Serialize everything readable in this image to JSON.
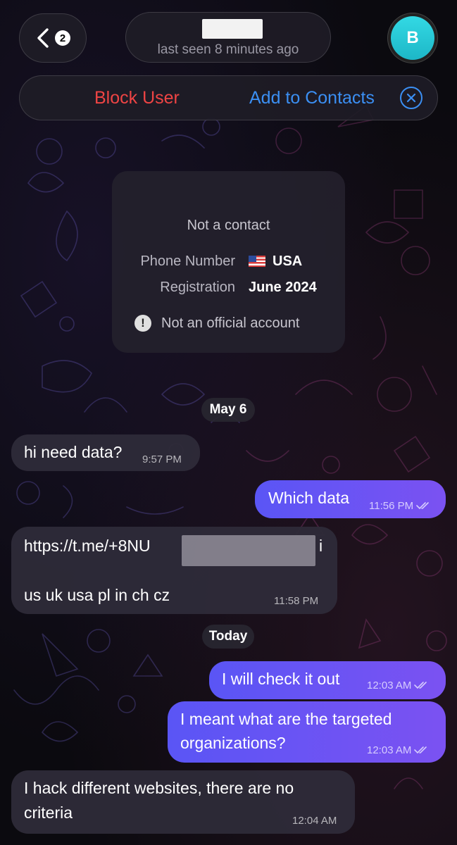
{
  "header": {
    "back_badge": "2",
    "last_seen": "last seen 8 minutes ago",
    "avatar_letter": "B"
  },
  "action_bar": {
    "block_label": "Block User",
    "add_contacts_label": "Add to Contacts"
  },
  "info_card": {
    "title": "Not a contact",
    "phone_label": "Phone Number",
    "phone_value": "USA",
    "registration_label": "Registration",
    "registration_value": "June 2024",
    "official_note": "Not an official account"
  },
  "dates": [
    "May 6",
    "Today"
  ],
  "messages": [
    {
      "direction": "in",
      "text": "hi need data?",
      "time": "9:57 PM"
    },
    {
      "direction": "out",
      "text": "Which data",
      "time": "11:56 PM"
    },
    {
      "direction": "in",
      "line1_start": "https://t.me/+8NU",
      "line1_end": "i",
      "line2": "us uk usa pl in ch cz",
      "time": "11:58 PM"
    },
    {
      "direction": "out",
      "text": "I will check it out",
      "time": "12:03 AM"
    },
    {
      "direction": "out",
      "line1": "I meant what are the targeted",
      "line2": "organizations?",
      "time": "12:03 AM"
    },
    {
      "direction": "in",
      "line1": "I hack different websites, there are no",
      "line2": "criteria",
      "time": "12:04 AM"
    }
  ],
  "colors": {
    "background": "#0b0a0f",
    "block": "#ef4444",
    "link": "#3b8ff3",
    "outgoing_bubble": "#6a53f4",
    "incoming_bubble": "#2e2b38",
    "avatar": "#2ac9d6"
  },
  "icons": [
    "chevron-left-icon",
    "close-circle-icon",
    "exclamation-icon",
    "double-check-icon",
    "usa-flag-icon"
  ]
}
